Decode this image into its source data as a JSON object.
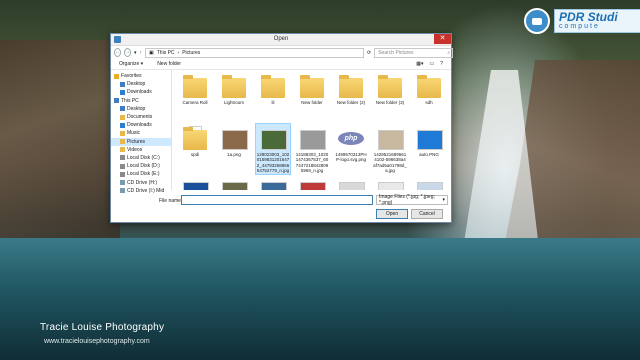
{
  "desktop": {
    "brand_name": "Tracie Louise Photography",
    "brand_url": "www.tracielouisephotography.com",
    "logo_line1": "PDR Studi",
    "logo_line2": "compute"
  },
  "dialog": {
    "title": "Open",
    "breadcrumb": [
      "This PC",
      "Pictures"
    ],
    "search_placeholder": "Search Pictures",
    "commands": [
      "Organize ▾",
      "New folder"
    ],
    "nav": [
      {
        "label": "Favorites",
        "icon": "star-icon",
        "indent": 0
      },
      {
        "label": "Desktop",
        "icon": "desktop-icon",
        "indent": 1
      },
      {
        "label": "Downloads",
        "icon": "download-icon",
        "indent": 1
      },
      {
        "label": "This PC",
        "icon": "computer-icon",
        "indent": 0
      },
      {
        "label": "Desktop",
        "icon": "desktop-icon",
        "indent": 1
      },
      {
        "label": "Documents",
        "icon": "folder-icon",
        "indent": 1
      },
      {
        "label": "Downloads",
        "icon": "download-icon",
        "indent": 1
      },
      {
        "label": "Music",
        "icon": "music-icon",
        "indent": 1
      },
      {
        "label": "Pictures",
        "icon": "pictures-icon",
        "indent": 1,
        "selected": true
      },
      {
        "label": "Videos",
        "icon": "video-icon",
        "indent": 1
      },
      {
        "label": "Local Disk (C:)",
        "icon": "drive-icon",
        "indent": 1
      },
      {
        "label": "Local Disk (D:)",
        "icon": "drive-icon",
        "indent": 1
      },
      {
        "label": "Local Disk (E:)",
        "icon": "drive-icon",
        "indent": 1
      },
      {
        "label": "CD Drive (H:)",
        "icon": "cd-icon",
        "indent": 1
      },
      {
        "label": "CD Drive (I:) Mid",
        "icon": "cd-icon",
        "indent": 1
      }
    ],
    "files": [
      {
        "label": "Camera Roll",
        "kind": "folder"
      },
      {
        "label": "Lightroom",
        "kind": "folder"
      },
      {
        "label": "lil",
        "kind": "folder"
      },
      {
        "label": "New folder",
        "kind": "folder"
      },
      {
        "label": "New folder (2)",
        "kind": "folder"
      },
      {
        "label": "New folder (3)",
        "kind": "folder"
      },
      {
        "label": "sdh",
        "kind": "folder"
      },
      {
        "label": "spdi",
        "kind": "folder-doc"
      },
      {
        "label": "1a.png",
        "kind": "image",
        "color": "#8a6a4a"
      },
      {
        "label": "128023003_10201598312016472_4478326886654752779_n.jpg",
        "kind": "image",
        "color": "#4a6a3a",
        "selected": true
      },
      {
        "label": "14188303_10201474367537_6074472188428095965_n.jpg",
        "kind": "image",
        "color": "#9a9a9a"
      },
      {
        "label": "1499570313PHP-logo.svg.png",
        "kind": "php"
      },
      {
        "label": "14295216896614102-596638a4af7ad5a01798d_a.jpg",
        "kind": "image",
        "color": "#c8b8a0"
      },
      {
        "label": "auto.PNG",
        "kind": "image",
        "color": "#1e7ad6"
      },
      {
        "label": "",
        "kind": "image",
        "color": "#1a4f9a"
      },
      {
        "label": "",
        "kind": "image",
        "color": "#6a6a4a"
      },
      {
        "label": "",
        "kind": "image",
        "color": "#3a6a9a"
      },
      {
        "label": "",
        "kind": "image",
        "color": "#c03a3a"
      },
      {
        "label": "",
        "kind": "image",
        "color": "#d8d8d8"
      },
      {
        "label": "",
        "kind": "image",
        "color": "#e8e8e8"
      },
      {
        "label": "",
        "kind": "image",
        "color": "#c8d8e8"
      }
    ],
    "filename_label": "File name:",
    "filename_value": "",
    "filetype": "Image Files (*.jpg; *.jpeg; *.png)",
    "open_label": "Open",
    "cancel_label": "Cancel"
  }
}
